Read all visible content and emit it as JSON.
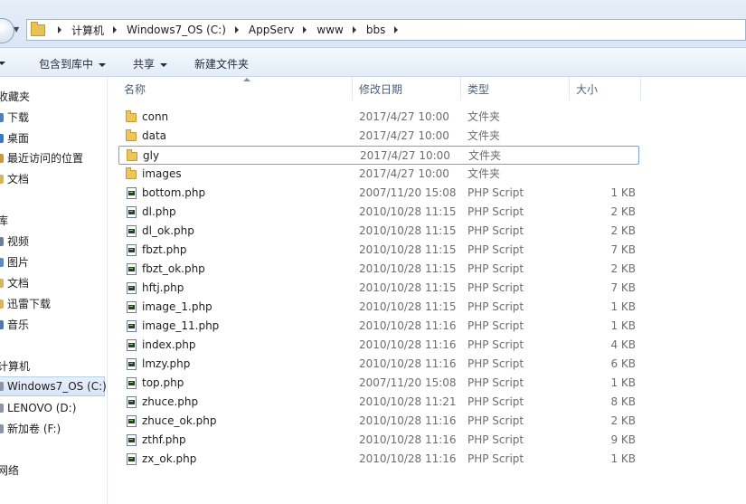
{
  "address_bar": {
    "path": [
      "计算机",
      "Windows7_OS (C:)",
      "AppServ",
      "www",
      "bbs"
    ]
  },
  "toolbar": {
    "include_library_label": "包含到库中",
    "share_label": "共享",
    "new_folder_label": "新建文件夹"
  },
  "navigation": {
    "favorites": {
      "label": "收藏夹",
      "items": [
        "下载",
        "桌面",
        "最近访问的位置"
      ]
    },
    "documents_label": "文档",
    "libraries": {
      "label": "库",
      "items": [
        "视频",
        "图片",
        "文档",
        "迅雷下载",
        "音乐"
      ]
    },
    "computer": {
      "label": "计算机",
      "items": [
        "Windows7_OS (C:)",
        "LENOVO (D:)",
        "新加卷 (F:)"
      ]
    },
    "network_label": "网络"
  },
  "columns": {
    "name": "名称",
    "date": "修改日期",
    "type": "类型",
    "size": "大小"
  },
  "files": [
    {
      "name": "conn",
      "date": "2017/4/27 10:00",
      "type": "文件夹",
      "size": "",
      "icon": "folder-icon"
    },
    {
      "name": "data",
      "date": "2017/4/27 10:00",
      "type": "文件夹",
      "size": "",
      "icon": "folder-icon"
    },
    {
      "name": "gly",
      "date": "2017/4/27 10:00",
      "type": "文件夹",
      "size": "",
      "icon": "folder-icon"
    },
    {
      "name": "images",
      "date": "2017/4/27 10:00",
      "type": "文件夹",
      "size": "",
      "icon": "folder-icon"
    },
    {
      "name": "bottom.php",
      "date": "2007/11/20 15:08",
      "type": "PHP Script",
      "size": "1 KB",
      "icon": "php-file-icon"
    },
    {
      "name": "dl.php",
      "date": "2010/10/28 11:15",
      "type": "PHP Script",
      "size": "2 KB",
      "icon": "php-file-icon"
    },
    {
      "name": "dl_ok.php",
      "date": "2010/10/28 11:15",
      "type": "PHP Script",
      "size": "2 KB",
      "icon": "php-file-icon"
    },
    {
      "name": "fbzt.php",
      "date": "2010/10/28 11:15",
      "type": "PHP Script",
      "size": "7 KB",
      "icon": "php-file-icon"
    },
    {
      "name": "fbzt_ok.php",
      "date": "2010/10/28 11:15",
      "type": "PHP Script",
      "size": "2 KB",
      "icon": "php-file-icon"
    },
    {
      "name": "hftj.php",
      "date": "2010/10/28 11:15",
      "type": "PHP Script",
      "size": "7 KB",
      "icon": "php-file-icon"
    },
    {
      "name": "image_1.php",
      "date": "2010/10/28 11:15",
      "type": "PHP Script",
      "size": "1 KB",
      "icon": "php-file-icon"
    },
    {
      "name": "image_11.php",
      "date": "2010/10/28 11:16",
      "type": "PHP Script",
      "size": "1 KB",
      "icon": "php-file-icon"
    },
    {
      "name": "index.php",
      "date": "2010/10/28 11:16",
      "type": "PHP Script",
      "size": "4 KB",
      "icon": "php-file-icon"
    },
    {
      "name": "lmzy.php",
      "date": "2010/10/28 11:16",
      "type": "PHP Script",
      "size": "6 KB",
      "icon": "php-file-icon"
    },
    {
      "name": "top.php",
      "date": "2007/11/20 15:08",
      "type": "PHP Script",
      "size": "1 KB",
      "icon": "php-file-icon"
    },
    {
      "name": "zhuce.php",
      "date": "2010/10/28 11:21",
      "type": "PHP Script",
      "size": "8 KB",
      "icon": "php-file-icon"
    },
    {
      "name": "zhuce_ok.php",
      "date": "2010/10/28 11:16",
      "type": "PHP Script",
      "size": "2 KB",
      "icon": "php-file-icon"
    },
    {
      "name": "zthf.php",
      "date": "2010/10/28 11:16",
      "type": "PHP Script",
      "size": "9 KB",
      "icon": "php-file-icon"
    },
    {
      "name": "zx_ok.php",
      "date": "2010/10/28 11:16",
      "type": "PHP Script",
      "size": "1 KB",
      "icon": "php-file-icon"
    }
  ],
  "focused_file": "gly",
  "selected_drive": "Windows7_OS (C:)",
  "colors": {
    "folder": "#edc55b",
    "selection_border": "#7da2ce",
    "header_text": "#4c607a"
  }
}
